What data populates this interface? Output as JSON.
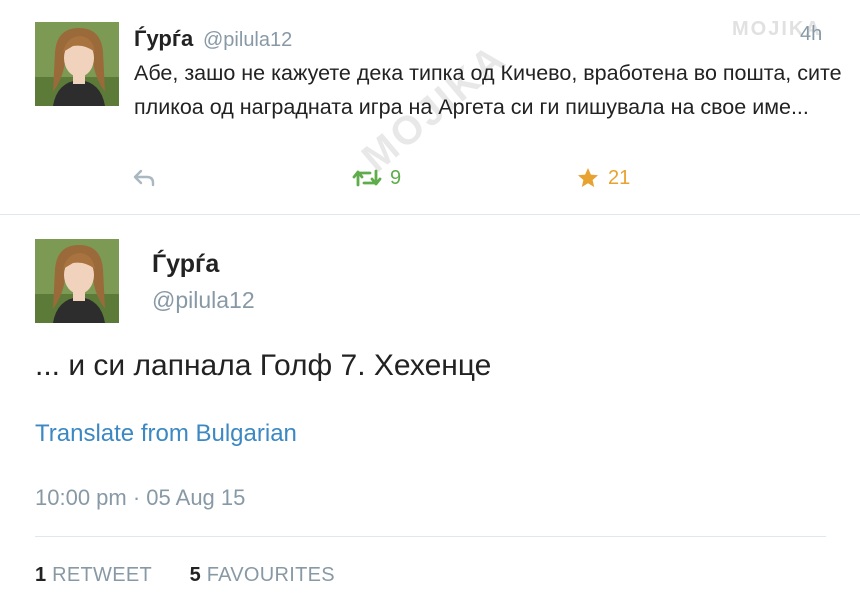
{
  "watermark": "MOJIKA",
  "tweet1": {
    "display_name": "Ѓурѓа",
    "handle": "@pilula12",
    "time": "4h",
    "text": "Абе, зашо не кажуете дека типка од Кичево, вработена во пошта, сите пликоа од наградната игра на Аргета си ги пишувала на свое име...",
    "retweet_count": "9",
    "favourite_count": "21",
    "icons": {
      "reply": "reply-icon",
      "retweet": "retweet-icon",
      "favourite": "star-icon"
    }
  },
  "tweet2": {
    "display_name": "Ѓурѓа",
    "handle": "@pilula12",
    "text": "... и си лапнала Голф 7. Хехенце",
    "translate_link": "Translate from Bulgarian",
    "timestamp": "10:00 pm · 05 Aug 15",
    "retweets_num": "1",
    "retweets_label": "RETWEET",
    "favourites_num": "5",
    "favourites_label": "FAVOURITES"
  },
  "colors": {
    "link": "#3b88c3",
    "retweet": "#5eac4a",
    "favourite": "#e8a230",
    "muted": "#8899a6"
  }
}
